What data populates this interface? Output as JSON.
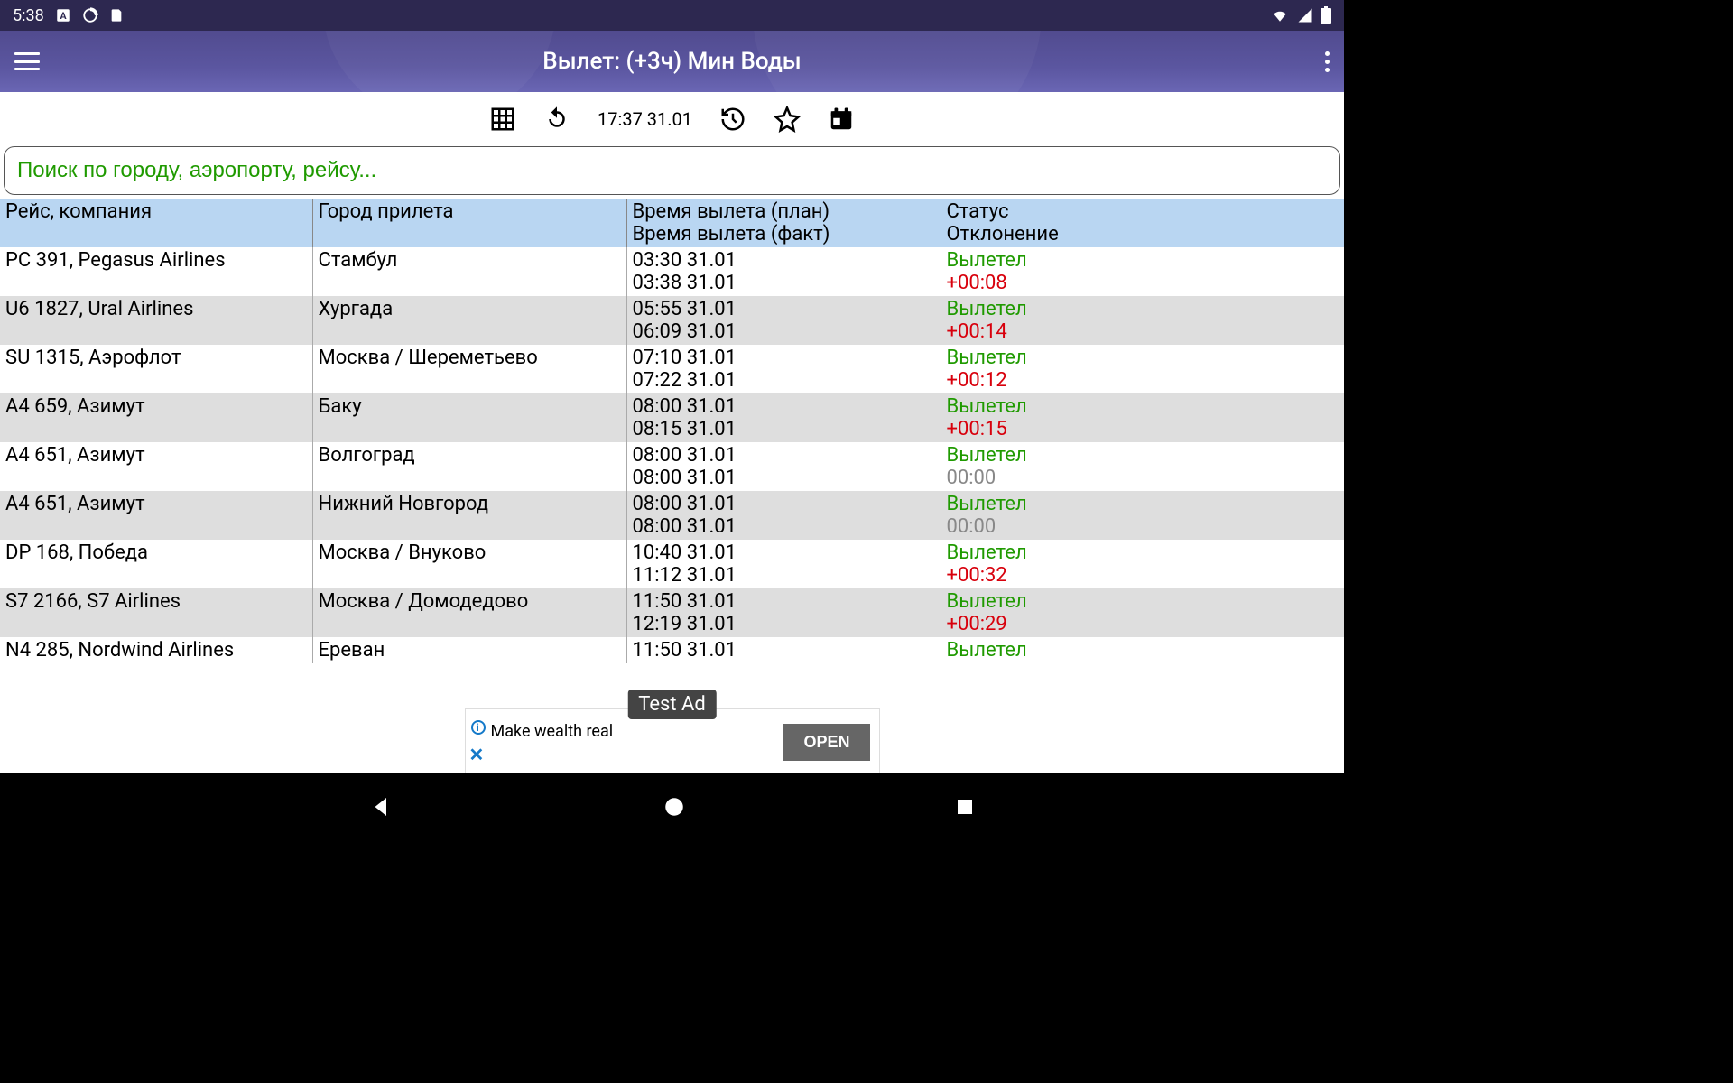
{
  "statusbar": {
    "time": "5:38"
  },
  "appbar": {
    "title": "Вылет: (+3ч) Мин Воды"
  },
  "toolbar": {
    "time_text": "17:37 31.01"
  },
  "search": {
    "placeholder": "Поиск по городу, аэропорту, рейсу..."
  },
  "headers": {
    "flight": "Рейс, компания",
    "dest": "Город прилета",
    "time1": "Время вылета (план)",
    "time2": "Время вылета (факт)",
    "status1": "Статус",
    "status2": "Отклонение"
  },
  "rows": [
    {
      "flight": "PC 391, Pegasus Airlines",
      "dest": "Стамбул",
      "tplan": "03:30 31.01",
      "tfact": "03:38 31.01",
      "status": "Вылетел",
      "dev": "+00:08",
      "dev_kind": "red"
    },
    {
      "flight": "U6 1827, Ural Airlines",
      "dest": "Хургада",
      "tplan": "05:55 31.01",
      "tfact": "06:09 31.01",
      "status": "Вылетел",
      "dev": "+00:14",
      "dev_kind": "red"
    },
    {
      "flight": "SU 1315, Аэрофлот",
      "dest": "Москва / Шереметьево",
      "tplan": "07:10 31.01",
      "tfact": "07:22 31.01",
      "status": "Вылетел",
      "dev": "+00:12",
      "dev_kind": "red"
    },
    {
      "flight": "A4 659, Азимут",
      "dest": "Баку",
      "tplan": "08:00 31.01",
      "tfact": "08:15 31.01",
      "status": "Вылетел",
      "dev": "+00:15",
      "dev_kind": "red"
    },
    {
      "flight": "A4 651, Азимут",
      "dest": "Волгоград",
      "tplan": "08:00 31.01",
      "tfact": "08:00 31.01",
      "status": "Вылетел",
      "dev": "00:00",
      "dev_kind": "gray"
    },
    {
      "flight": "A4 651, Азимут",
      "dest": "Нижний Новгород",
      "tplan": "08:00 31.01",
      "tfact": "08:00 31.01",
      "status": "Вылетел",
      "dev": "00:00",
      "dev_kind": "gray"
    },
    {
      "flight": "DP 168, Победа",
      "dest": "Москва / Внуково",
      "tplan": "10:40 31.01",
      "tfact": "11:12 31.01",
      "status": "Вылетел",
      "dev": "+00:32",
      "dev_kind": "red"
    },
    {
      "flight": "S7 2166, S7 Airlines",
      "dest": "Москва / Домодедово",
      "tplan": "11:50 31.01",
      "tfact": "12:19 31.01",
      "status": "Вылетел",
      "dev": "+00:29",
      "dev_kind": "red"
    },
    {
      "flight": "N4 285, Nordwind Airlines",
      "dest": "Ереван",
      "tplan": "11:50 31.01",
      "tfact": "",
      "status": "Вылетел",
      "dev": "",
      "dev_kind": ""
    }
  ],
  "ad": {
    "badge": "Test Ad",
    "text": "Make wealth real",
    "button": "OPEN"
  }
}
